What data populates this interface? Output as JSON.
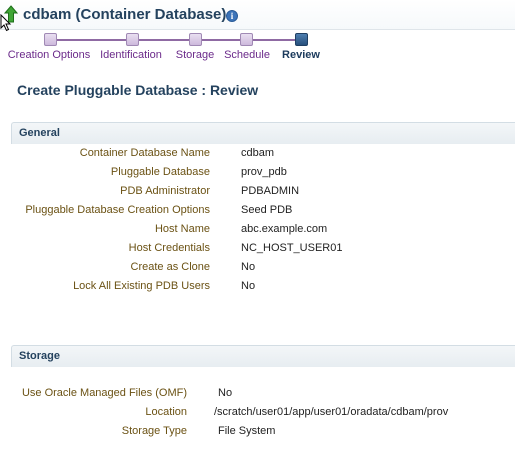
{
  "header": {
    "title": "cdbam (Container Database)",
    "info_icon": "information-icon",
    "up_icon": "up-arrow-icon"
  },
  "train": {
    "steps": [
      {
        "label": "Creation Options",
        "state": "visited"
      },
      {
        "label": "Identification",
        "state": "visited"
      },
      {
        "label": "Storage",
        "state": "visited"
      },
      {
        "label": "Schedule",
        "state": "visited"
      },
      {
        "label": "Review",
        "state": "current"
      }
    ]
  },
  "page": {
    "heading": "Create Pluggable Database : Review"
  },
  "general": {
    "title": "General",
    "rows": [
      {
        "label": "Container Database Name",
        "value": "cdbam"
      },
      {
        "label": "Pluggable Database",
        "value": "prov_pdb"
      },
      {
        "label": "PDB Administrator",
        "value": "PDBADMIN"
      },
      {
        "label": "Pluggable Database Creation Options",
        "value": "Seed PDB"
      },
      {
        "label": "Host Name",
        "value": "abc.example.com"
      },
      {
        "label": "Host Credentials",
        "value": "NC_HOST_USER01"
      },
      {
        "label": "Create as Clone",
        "value": "No"
      },
      {
        "label": "Lock All Existing PDB Users",
        "value": "No"
      }
    ]
  },
  "storage": {
    "title": "Storage",
    "rows": [
      {
        "label": "Use Oracle Managed Files (OMF)",
        "value": "No"
      },
      {
        "label": "Location",
        "value": "/scratch/user01/app/user01/oradata/cdbam/prov"
      },
      {
        "label": "Storage Type",
        "value": "File System"
      }
    ]
  },
  "colors": {
    "title_blue": "#24425e",
    "label_brown": "#6b5214",
    "train_purple": "#6b2a8a",
    "current_step": "#274f7c"
  }
}
